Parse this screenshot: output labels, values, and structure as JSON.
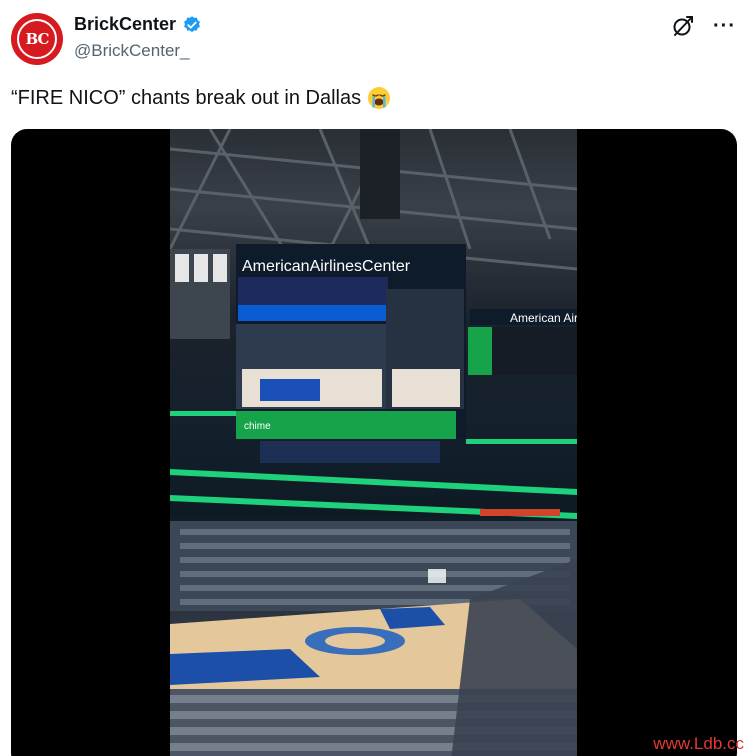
{
  "account": {
    "display_name": "BrickCenter",
    "handle": "@BrickCenter_",
    "avatar_text": "BC",
    "verified": true
  },
  "icons": {
    "avatar": "brickcenter-logo",
    "verified": "verified-badge-icon",
    "grok": "grok-icon",
    "more": "more-icon",
    "emoji": "crying-face-emoji"
  },
  "post": {
    "text": "“FIRE NICO” chants break out in Dallas",
    "emoji": "😭"
  },
  "media": {
    "type": "video",
    "scene": {
      "arena_sign": "AmericanAirlinesCenter",
      "side_sign": "American Airlines",
      "ad_brand": "chime"
    }
  },
  "watermark": "www.Ldb.cc",
  "colors": {
    "verified_blue": "#1d9bf0",
    "brand_red": "#d71920",
    "arena_green": "#1fd17a",
    "watermark_red": "#e53935"
  }
}
